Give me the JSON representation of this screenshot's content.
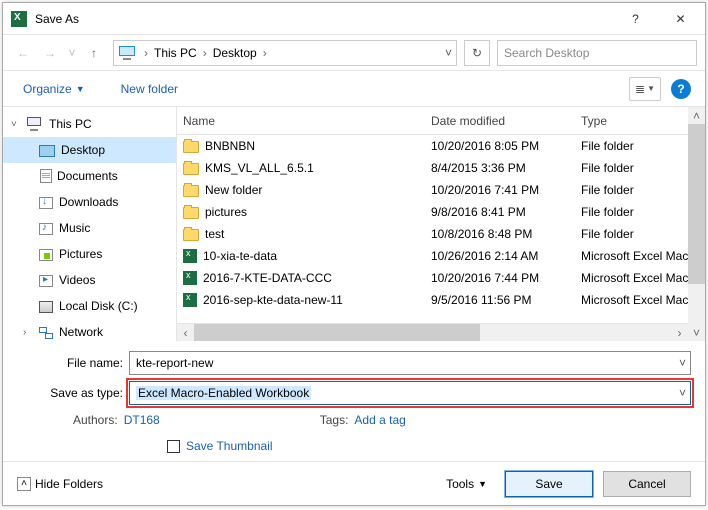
{
  "titlebar": {
    "title": "Save As"
  },
  "nav": {
    "crumbs": [
      "This PC",
      "Desktop"
    ],
    "search_placeholder": "Search Desktop"
  },
  "toolbar": {
    "organize": "Organize",
    "newfolder": "New folder"
  },
  "sidebar": {
    "items": [
      {
        "label": "This PC",
        "icon": "pc",
        "expand": "˅"
      },
      {
        "label": "Desktop",
        "icon": "desktop",
        "selected": true
      },
      {
        "label": "Documents",
        "icon": "doc"
      },
      {
        "label": "Downloads",
        "icon": "down"
      },
      {
        "label": "Music",
        "icon": "music"
      },
      {
        "label": "Pictures",
        "icon": "pic"
      },
      {
        "label": "Videos",
        "icon": "vid"
      },
      {
        "label": "Local Disk (C:)",
        "icon": "disk"
      },
      {
        "label": "Network",
        "icon": "net",
        "expand": "›"
      }
    ]
  },
  "columns": {
    "name": "Name",
    "date": "Date modified",
    "type": "Type"
  },
  "files": [
    {
      "name": "BNBNBN",
      "date": "10/20/2016 8:05 PM",
      "type": "File folder",
      "icon": "folder"
    },
    {
      "name": "KMS_VL_ALL_6.5.1",
      "date": "8/4/2015 3:36 PM",
      "type": "File folder",
      "icon": "folder"
    },
    {
      "name": "New folder",
      "date": "10/20/2016 7:41 PM",
      "type": "File folder",
      "icon": "folder"
    },
    {
      "name": "pictures",
      "date": "9/8/2016 8:41 PM",
      "type": "File folder",
      "icon": "folder"
    },
    {
      "name": "test",
      "date": "10/8/2016 8:48 PM",
      "type": "File folder",
      "icon": "folder"
    },
    {
      "name": "10-xia-te-data",
      "date": "10/26/2016 2:14 AM",
      "type": "Microsoft Excel Macro-",
      "icon": "xlsm"
    },
    {
      "name": "2016-7-KTE-DATA-CCC",
      "date": "10/20/2016 7:44 PM",
      "type": "Microsoft Excel Macro-",
      "icon": "xlsm"
    },
    {
      "name": "2016-sep-kte-data-new-11",
      "date": "9/5/2016 11:56 PM",
      "type": "Microsoft Excel Macro-",
      "icon": "xlsm"
    }
  ],
  "form": {
    "filename_label": "File name:",
    "filename_value": "kte-report-new",
    "savetype_label": "Save as type:",
    "savetype_value": "Excel Macro-Enabled Workbook",
    "authors_label": "Authors:",
    "authors_value": "DT168",
    "tags_label": "Tags:",
    "tags_value": "Add a tag",
    "thumb_label": "Save Thumbnail"
  },
  "footer": {
    "hide": "Hide Folders",
    "tools": "Tools",
    "save": "Save",
    "cancel": "Cancel"
  }
}
